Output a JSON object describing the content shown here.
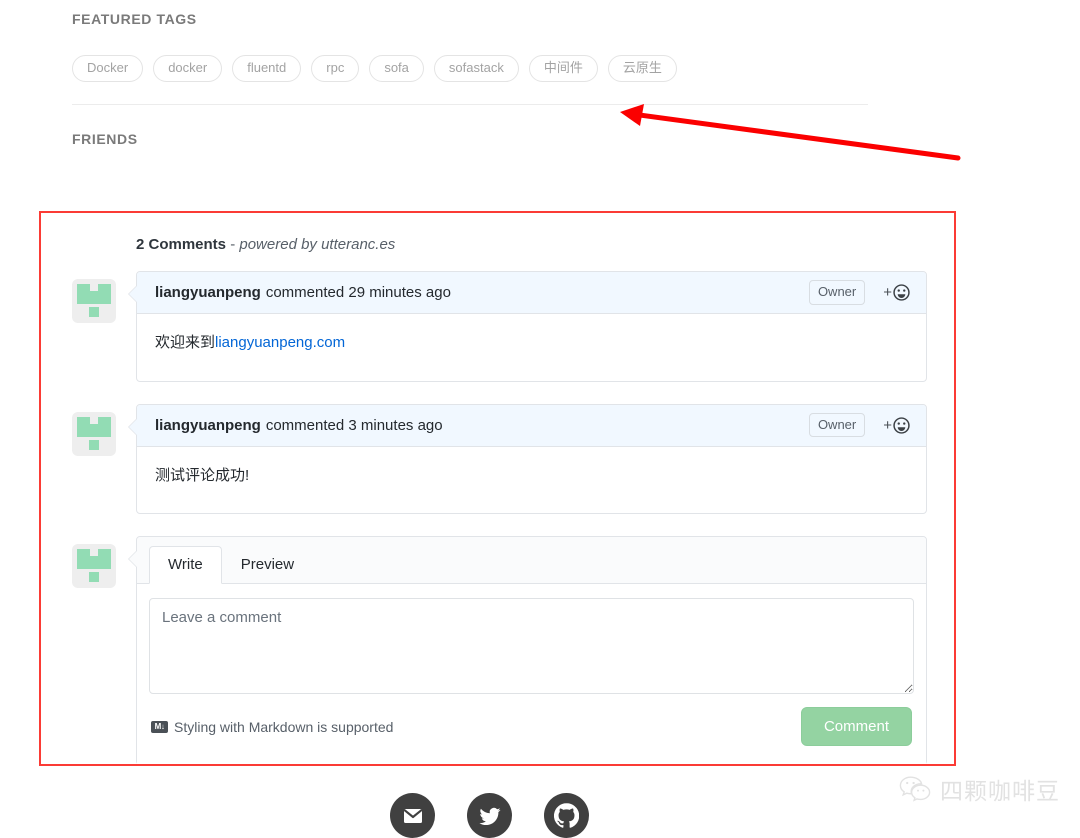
{
  "sidebar": {
    "featured_tags_heading": "FEATURED TAGS",
    "tags": [
      {
        "label": "Docker"
      },
      {
        "label": "docker"
      },
      {
        "label": "fluentd"
      },
      {
        "label": "rpc"
      },
      {
        "label": "sofa"
      },
      {
        "label": "sofastack"
      },
      {
        "label": "中间件"
      },
      {
        "label": "云原生"
      }
    ],
    "friends_heading": "FRIENDS"
  },
  "comments": {
    "count_label": "2 Comments",
    "separator": "-",
    "powered_by": "powered by utteranc.es",
    "items": [
      {
        "author": "liangyuanpeng",
        "meta": "commented 29 minutes ago",
        "badge": "Owner",
        "react_plus": "+",
        "body_prefix": "欢迎来到",
        "body_link": "liangyuanpeng.com"
      },
      {
        "author": "liangyuanpeng",
        "meta": "commented 3 minutes ago",
        "badge": "Owner",
        "react_plus": "+",
        "body_prefix": "测试评论成功!",
        "body_link": ""
      }
    ]
  },
  "comment_form": {
    "tabs": [
      {
        "label": "Write",
        "active": true
      },
      {
        "label": "Preview",
        "active": false
      }
    ],
    "textarea_placeholder": "Leave a comment",
    "textarea_value": "",
    "markdown_note": "Styling with Markdown is supported",
    "markdown_icon_text": "M↓",
    "submit_label": "Comment"
  },
  "footer": {
    "social": [
      {
        "name": "email-icon"
      },
      {
        "name": "twitter-icon"
      },
      {
        "name": "github-icon"
      }
    ]
  },
  "watermark": {
    "text": "四颗咖啡豆"
  },
  "annotations": {
    "rect_color": "#fb3b35",
    "arrow_color": "#fb0000"
  }
}
